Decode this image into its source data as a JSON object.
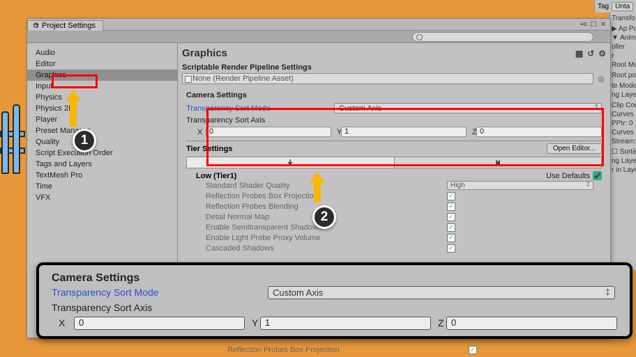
{
  "window": {
    "tab_title": "Project Settings"
  },
  "sidebar": {
    "items": [
      {
        "label": "Audio"
      },
      {
        "label": "Editor"
      },
      {
        "label": "Graphics",
        "selected": true
      },
      {
        "label": "Input"
      },
      {
        "label": "Physics"
      },
      {
        "label": "Physics 2D"
      },
      {
        "label": "Player"
      },
      {
        "label": "Preset Manager"
      },
      {
        "label": "Quality"
      },
      {
        "label": "Script Execution Order"
      },
      {
        "label": "Tags and Layers"
      },
      {
        "label": "TextMesh Pro"
      },
      {
        "label": "Time"
      },
      {
        "label": "VFX"
      }
    ]
  },
  "main": {
    "title": "Graphics",
    "pipeline_title": "Scriptable Render Pipeline Settings",
    "pipeline_value": "None (Render Pipeline Asset)",
    "camera": {
      "title": "Camera Settings",
      "mode_label": "Transparency Sort Mode",
      "mode_value": "Custom Axis",
      "axis_label": "Transparency Sort Axis",
      "x": "0",
      "y": "1",
      "z": "0"
    },
    "tier": {
      "title": "Tier Settings",
      "open_button": "Open Editor...",
      "tier_name": "Low (Tier1)",
      "use_defaults": "Use Defaults",
      "props": [
        {
          "label": "Standard Shader Quality",
          "type": "dropdown",
          "value": "High"
        },
        {
          "label": "Reflection Probes Box Projection",
          "type": "check",
          "checked": true
        },
        {
          "label": "Reflection Probes Blending",
          "type": "check",
          "checked": true
        },
        {
          "label": "Detail Normal Map",
          "type": "check",
          "checked": true
        },
        {
          "label": "Enable Semitransparent Shadows",
          "type": "check",
          "checked": true
        },
        {
          "label": "Enable Light Probe Proxy Volume",
          "type": "check",
          "checked": true
        },
        {
          "label": "Cascaded Shadows",
          "type": "check",
          "checked": true
        }
      ],
      "after_zoom": [
        {
          "label": "Reflection Probes Box Projection",
          "type": "check",
          "checked": true
        }
      ]
    }
  },
  "zoom": {
    "title": "Camera Settings",
    "mode_label": "Transparency Sort Mode",
    "mode_value": "Custom Axis",
    "axis_label": "Transparency Sort Axis",
    "x": "0",
    "y": "1",
    "z": "0"
  },
  "right": {
    "tag": "Tag",
    "btn": "Unta",
    "items": [
      "Transfo",
      "",
      "▶ Ap Por",
      "▼ Anima",
      "oller",
      "r",
      "Root Mo",
      "",
      "Root pos",
      "",
      "te Mode",
      "ng Layer",
      "",
      "Clip Cou",
      "Curves P",
      "PPtr: 0",
      "Curves C",
      "Stream:",
      "",
      "☐ Sorting",
      "ng Layer",
      "r in Laye"
    ]
  },
  "callouts": {
    "one": "1",
    "two": "2"
  }
}
